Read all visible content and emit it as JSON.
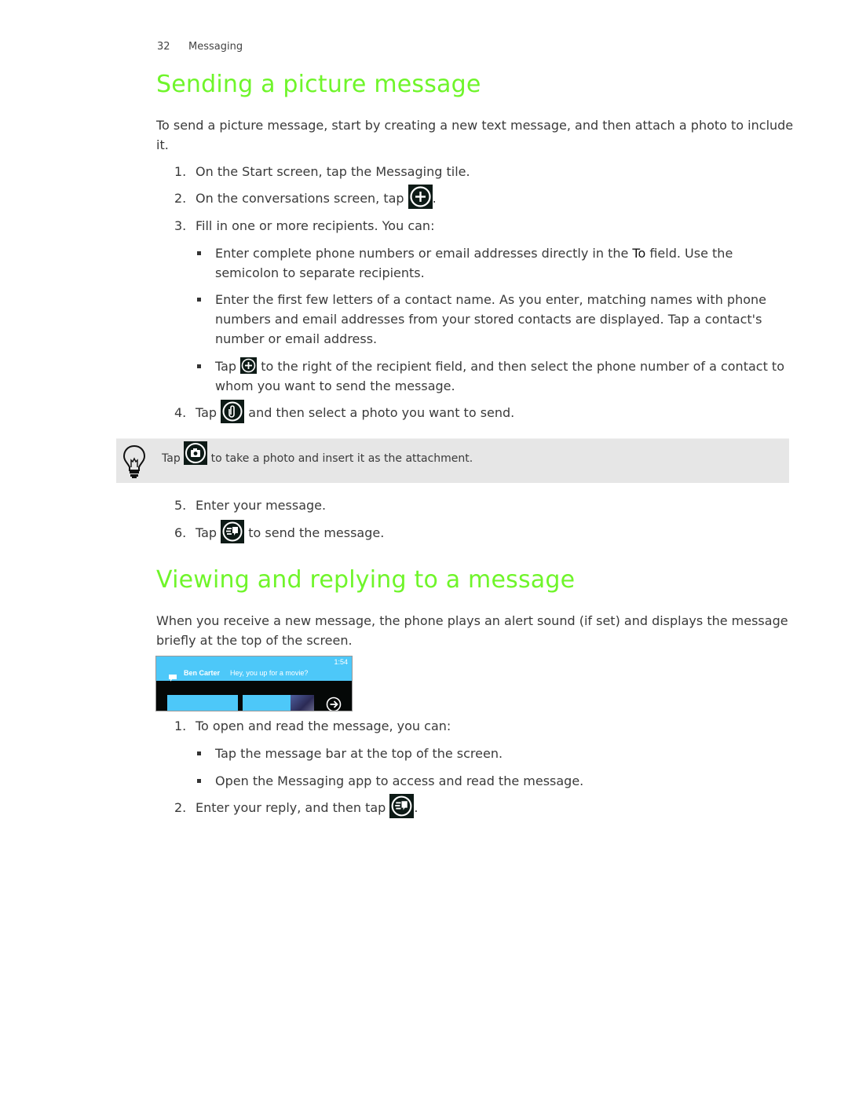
{
  "running_head": {
    "page_number": "32",
    "chapter": "Messaging"
  },
  "colors": {
    "heading": "#6ff52a",
    "notification_bar": "#4dc8f9",
    "icon_background": "#0d1a16",
    "tip_background": "#e6e6e6"
  },
  "section1": {
    "title": "Sending a picture message",
    "intro": "To send a picture message, start by creating a new text message, and then attach a photo to include it.",
    "steps": [
      {
        "num": "1.",
        "text": "On the Start screen, tap the Messaging tile."
      },
      {
        "num": "2.",
        "text_before": "On the conversations screen, tap ",
        "icon": "add-circle-icon",
        "text_after": "."
      },
      {
        "num": "3.",
        "text": "Fill in one or more recipients. You can:"
      },
      {
        "num": "4.",
        "text_before": "Tap ",
        "icon": "attach-paperclip-icon",
        "text_after": " and then select a photo you want to send."
      },
      {
        "num": "5.",
        "text": "Enter your message."
      },
      {
        "num": "6.",
        "text_before": "Tap ",
        "icon": "send-icon",
        "text_after": " to send the message."
      }
    ],
    "bullets": [
      {
        "text_before": "Enter complete phone numbers or email addresses directly in the ",
        "bold": "To",
        "text_after": " field. Use the semicolon to separate recipients."
      },
      {
        "text": "Enter the first few letters of a contact name. As you enter, matching names with phone numbers and email addresses from your stored contacts are displayed. Tap a contact's number or email address."
      },
      {
        "text_before": "Tap ",
        "icon": "add-circle-icon",
        "text_after": " to the right of the recipient field, and then select the phone number of a contact to whom you want to send the message."
      }
    ],
    "tip": {
      "icon": "lightbulb-icon",
      "text_before": "Tap ",
      "inline_icon": "camera-icon",
      "text_after": " to take a photo and insert it as the attachment."
    }
  },
  "section2": {
    "title": "Viewing and replying to a message",
    "intro": "When you receive a new message, the phone plays an alert sound (if set) and displays the message briefly at the top of the screen.",
    "screenshot": {
      "time": "1:54",
      "sender": "Ben Carter",
      "preview": "Hey, you up for a movie?"
    },
    "steps": [
      {
        "num": "1.",
        "text": "To open and read the message, you can:"
      },
      {
        "num": "2.",
        "text_before": "Enter your reply, and then tap ",
        "icon": "send-icon",
        "text_after": "."
      }
    ],
    "bullets": [
      {
        "text": "Tap the message bar at the top of the screen."
      },
      {
        "text": "Open the Messaging app to access and read the message."
      }
    ]
  }
}
